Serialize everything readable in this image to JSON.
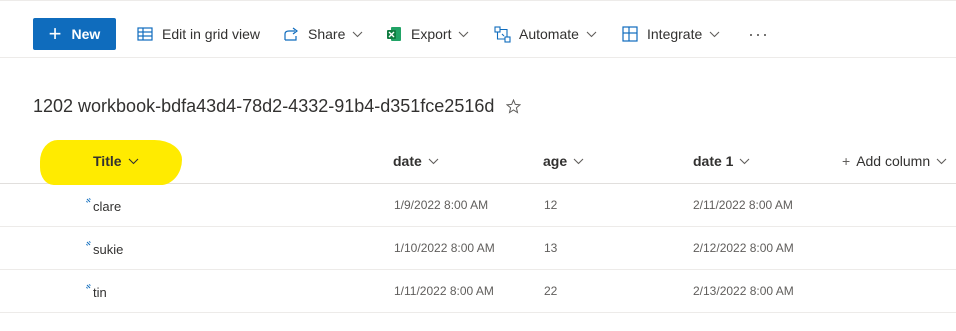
{
  "toolbar": {
    "new_label": "New",
    "edit_grid_label": "Edit in grid view",
    "share_label": "Share",
    "export_label": "Export",
    "automate_label": "Automate",
    "integrate_label": "Integrate",
    "more_label": "···"
  },
  "list": {
    "title": "1202 workbook-bdfa43d4-78d2-4332-91b4-d351fce2516d"
  },
  "columns": {
    "title": "Title",
    "date": "date",
    "age": "age",
    "date1": "date 1",
    "add": "Add column"
  },
  "rows": [
    {
      "title": "clare",
      "date": "1/9/2022 8:00 AM",
      "age": "12",
      "date1": "2/11/2022 8:00 AM"
    },
    {
      "title": "sukie",
      "date": "1/10/2022 8:00 AM",
      "age": "13",
      "date1": "2/12/2022 8:00 AM"
    },
    {
      "title": "tin",
      "date": "1/11/2022 8:00 AM",
      "age": "22",
      "date1": "2/13/2022 8:00 AM"
    }
  ],
  "colors": {
    "accent": "#0f6cbd",
    "highlight": "#ffeb00",
    "excel_green": "#107c41"
  },
  "icons": {
    "new": "plus-icon",
    "edit_grid": "grid-icon",
    "share": "share-icon",
    "export": "excel-icon",
    "automate": "automate-icon",
    "integrate": "integrate-icon",
    "favorite": "star-icon",
    "new_item": "new-item-sparkle-icon"
  }
}
